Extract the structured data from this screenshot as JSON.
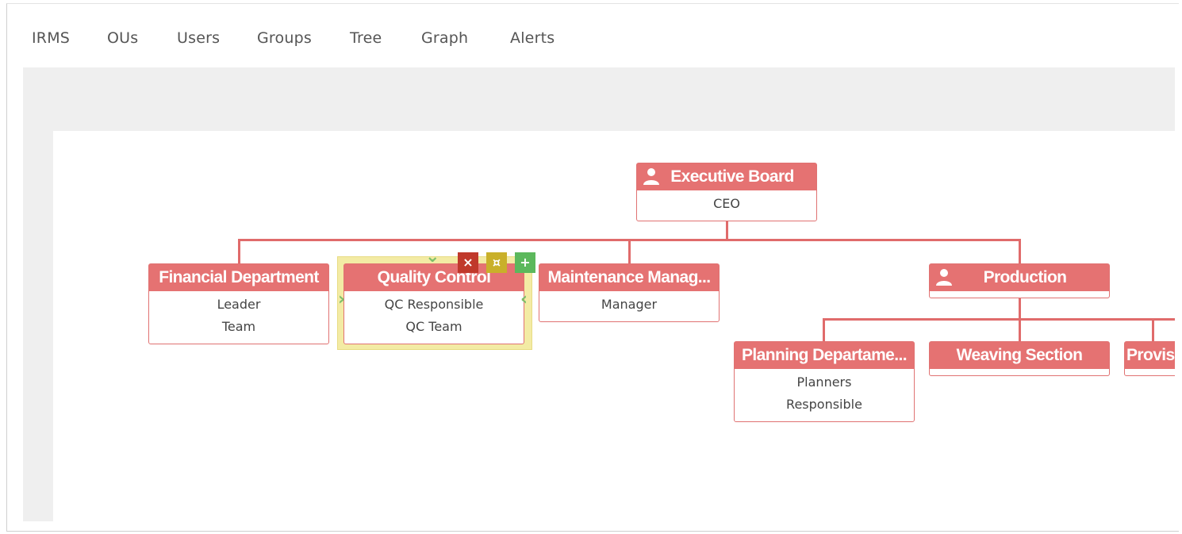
{
  "nav": {
    "items": [
      {
        "label": "IRMS"
      },
      {
        "label": "OUs"
      },
      {
        "label": "Users"
      },
      {
        "label": "Groups"
      },
      {
        "label": "Tree"
      },
      {
        "label": "Graph"
      },
      {
        "label": "Alerts"
      }
    ]
  },
  "org": {
    "executive": {
      "title": "Executive Board",
      "roles": [
        "CEO"
      ]
    },
    "financial": {
      "title": "Financial Department",
      "roles": [
        "Leader",
        "Team"
      ]
    },
    "quality": {
      "title": "Quality Control",
      "roles": [
        "QC Responsible",
        "QC Team"
      ]
    },
    "maintenance": {
      "title": "Maintenance Manag...",
      "roles": [
        "Manager"
      ]
    },
    "production": {
      "title": "Production",
      "roles": []
    },
    "planning": {
      "title": "Planning Departame...",
      "roles": [
        "Planners",
        "Responsible"
      ]
    },
    "weaving": {
      "title": "Weaving Section",
      "roles": []
    },
    "provision": {
      "title": "Provisi",
      "roles": []
    }
  },
  "tools": {
    "delete": "×",
    "edit": "¤",
    "add": "+"
  },
  "chevrons": {
    "down": "⌄",
    "right": "›",
    "left": "‹"
  },
  "colors": {
    "node_header": "#e57272",
    "connector": "#e06b6b",
    "selection": "#f3eba4",
    "delete_button": "#c0392b",
    "edit_button": "#c9b02a",
    "add_button": "#5cb85c"
  }
}
